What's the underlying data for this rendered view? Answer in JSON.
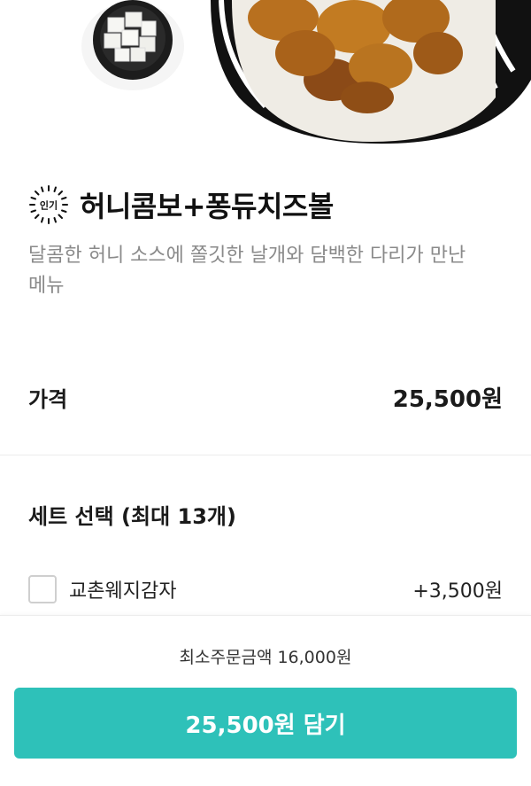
{
  "product": {
    "badge_text": "인기",
    "name": "허니콤보+퐁듀치즈볼",
    "description": "달콤한 허니 소스에 쫄깃한 날개와 담백한 다리가 만난 메뉴"
  },
  "price": {
    "label": "가격",
    "value": "25,500원"
  },
  "set_selection": {
    "title": "세트 선택 (최대 13개)",
    "options": [
      {
        "name": "교촌웨지감자",
        "price": "+3,500원",
        "checked": false
      }
    ]
  },
  "footer": {
    "min_order": "최소주문금액 16,000원",
    "cta_label": "25,500원 담기"
  },
  "colors": {
    "accent": "#2ec1b9",
    "text_muted": "#8a8a8a"
  }
}
